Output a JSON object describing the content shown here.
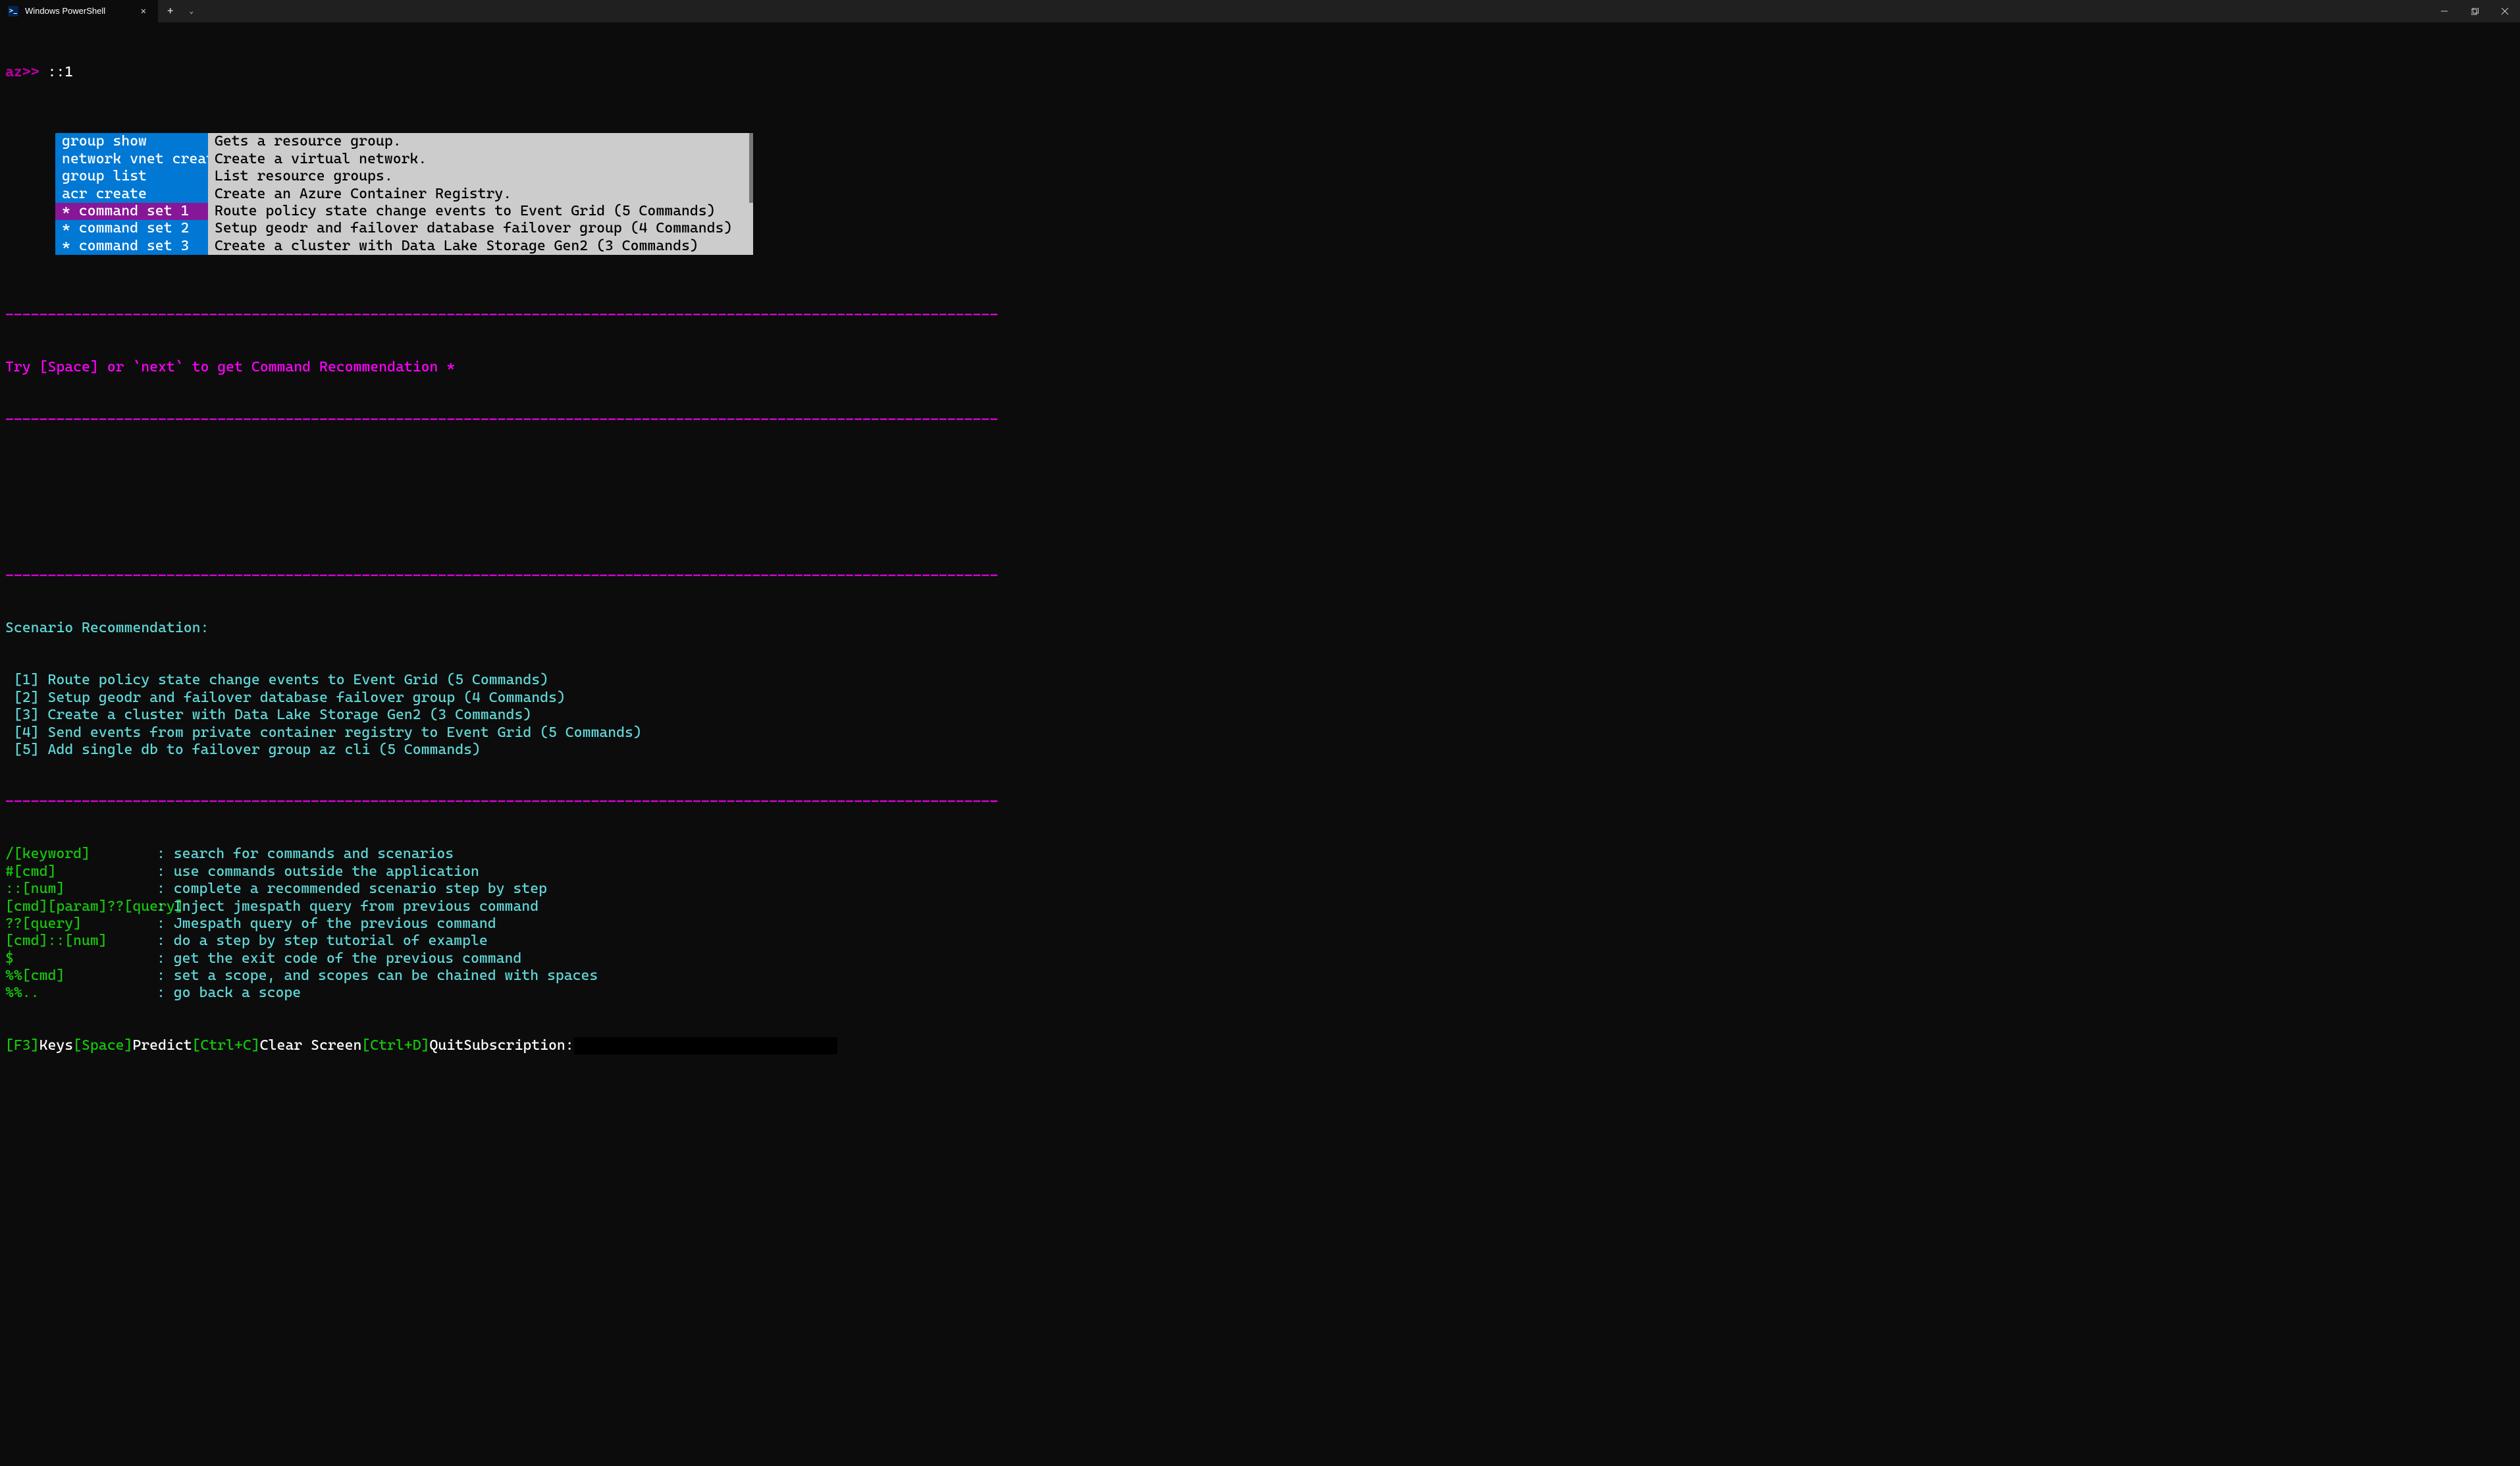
{
  "window": {
    "tab_title": "Windows PowerShell"
  },
  "prompt": {
    "label": "az>> ",
    "input": "::1"
  },
  "dropdown": {
    "rows": [
      {
        "cmd": "group show",
        "desc": "Gets a resource group.",
        "selected": false
      },
      {
        "cmd": "network vnet create",
        "desc": "Create a virtual network.",
        "selected": false
      },
      {
        "cmd": "group list",
        "desc": "List resource groups.",
        "selected": false
      },
      {
        "cmd": "acr create",
        "desc": "Create an Azure Container Registry.",
        "selected": false
      },
      {
        "cmd": "* command set 1",
        "desc": "Route policy state change events to Event Grid (5 Commands)",
        "selected": true
      },
      {
        "cmd": "* command set 2",
        "desc": "Setup geodr and failover database failover group (4 Commands)",
        "selected": false
      },
      {
        "cmd": "* command set 3",
        "desc": "Create a cluster with Data Lake Storage Gen2 (3 Commands)",
        "selected": false
      }
    ]
  },
  "hint": {
    "text": "Try [Space] or `next` to get Command Recommendation ",
    "star": "*"
  },
  "scenario": {
    "heading": "Scenario Recommendation:",
    "items": [
      " [1] Route policy state change events to Event Grid (5 Commands)",
      " [2] Setup geodr and failover database failover group (4 Commands)",
      " [3] Create a cluster with Data Lake Storage Gen2 (3 Commands)",
      " [4] Send events from private container registry to Event Grid (5 Commands)",
      " [5] Add single db to failover group az cli (5 Commands)"
    ]
  },
  "help": {
    "rows": [
      {
        "key": "/[keyword]",
        "desc": ": search for commands and scenarios"
      },
      {
        "key": "#[cmd]",
        "desc": ": use commands outside the application"
      },
      {
        "key": "::[num]",
        "desc": ": complete a recommended scenario step by step"
      },
      {
        "key": "[cmd][param]??[query]",
        "desc": ": Inject jmespath query from previous command"
      },
      {
        "key": "??[query]",
        "desc": ": Jmespath query of the previous command"
      },
      {
        "key": "[cmd]::[num]",
        "desc": ": do a step by step tutorial of example"
      },
      {
        "key": "$",
        "desc": ": get the exit code of the previous command"
      },
      {
        "key": "%%[cmd]",
        "desc": ": set a scope, and scopes can be chained with spaces"
      },
      {
        "key": "%%..",
        "desc": ": go back a scope"
      }
    ]
  },
  "statusbar": {
    "f3": "[F3]",
    "keys": "Keys",
    "space": "[Space]",
    "predict": "Predict",
    "ctrlc": "[Ctrl+C]",
    "clear": "Clear Screen",
    "ctrld": "[Ctrl+D]",
    "quit": "Quit",
    "sub_label": "Subscription:"
  },
  "dashes": "---------------------------------------------------------------------------------------------------------------------"
}
